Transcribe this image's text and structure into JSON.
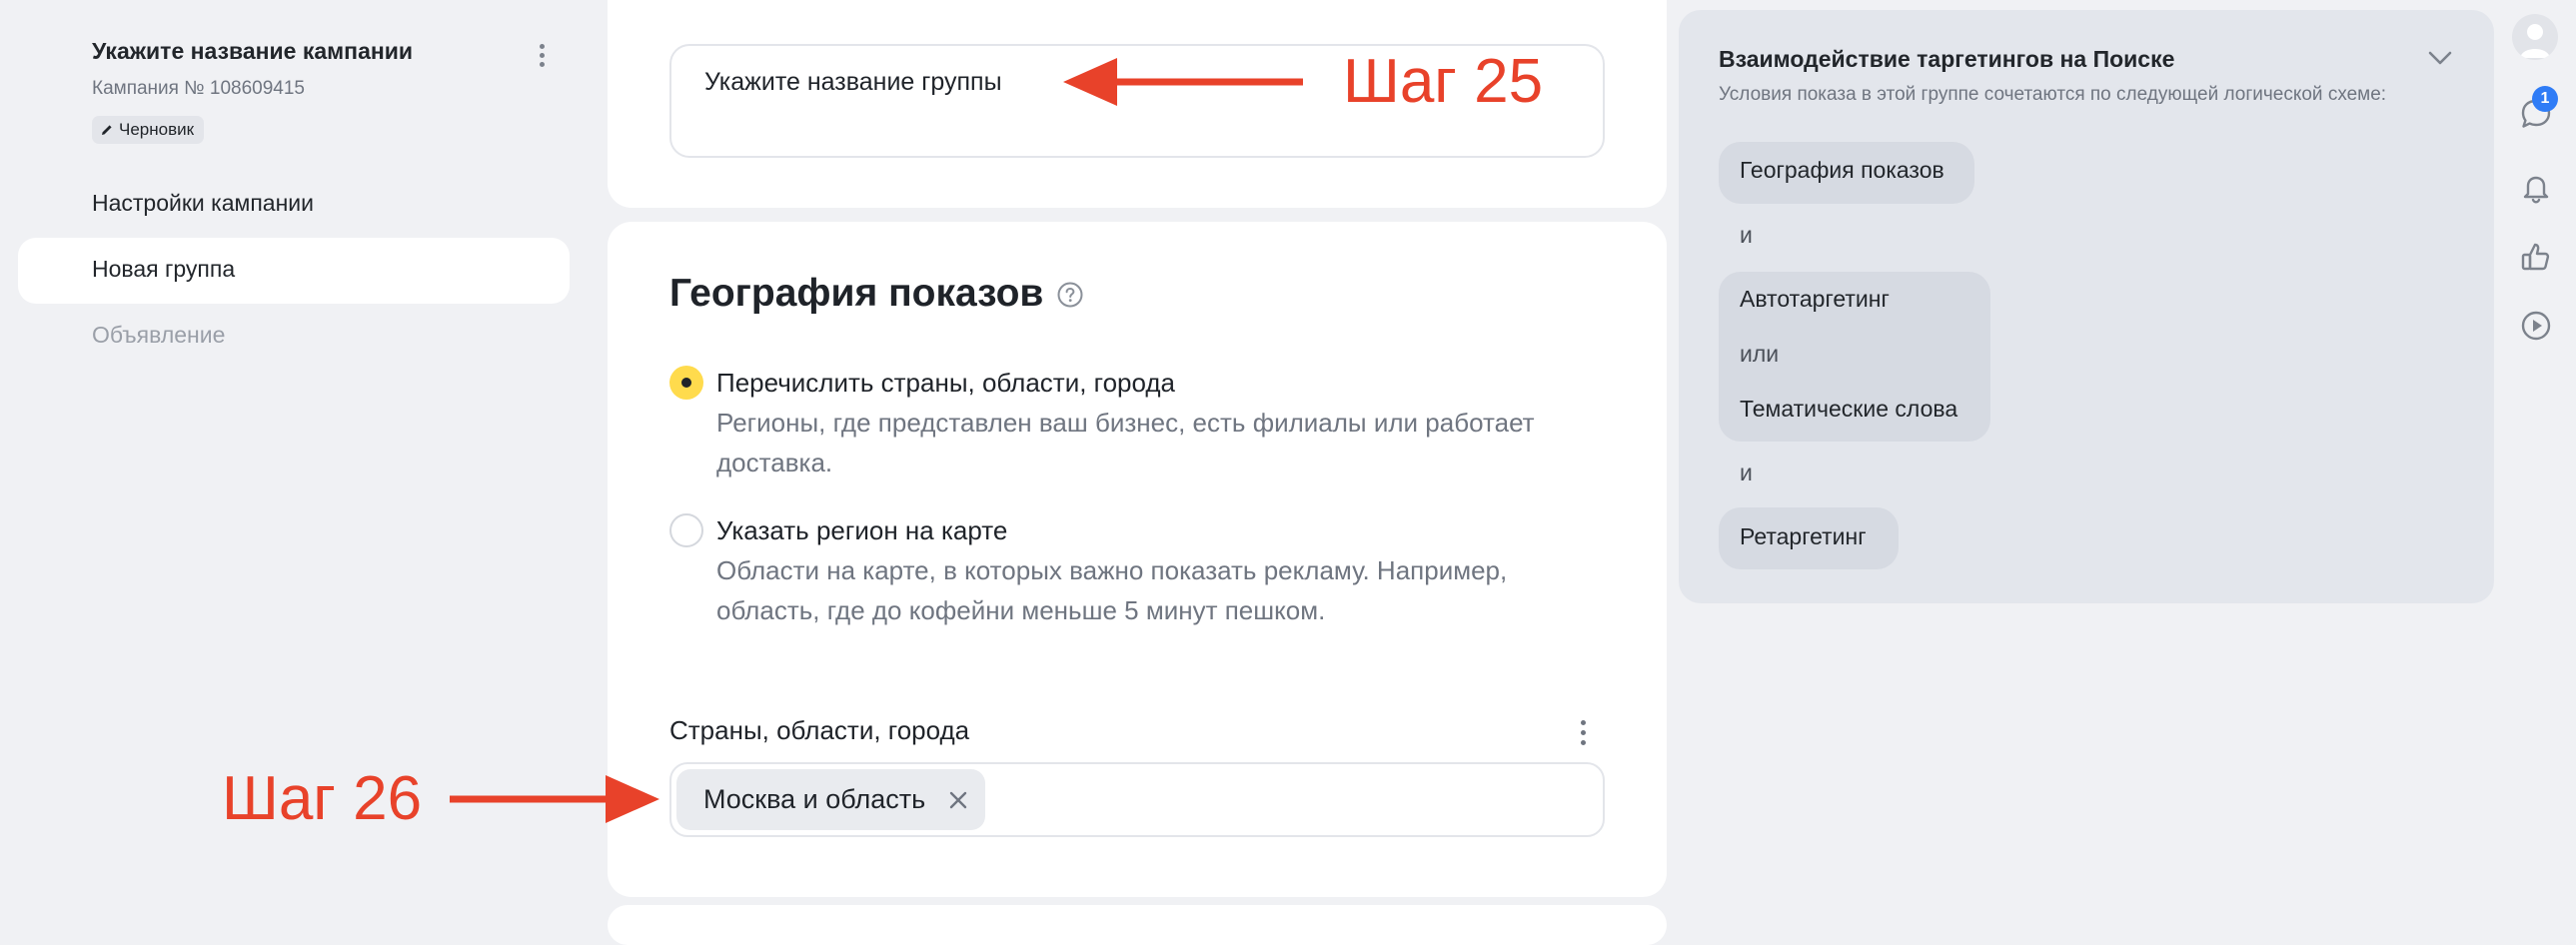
{
  "sidebar": {
    "campaign_title": "Укажите название кампании",
    "campaign_number": "Кампания № 108609415",
    "status_badge": "Черновик",
    "nav": {
      "settings": "Настройки кампании",
      "new_group": "Новая группа",
      "ad": "Объявление"
    }
  },
  "group": {
    "name_placeholder": "Укажите название группы"
  },
  "geo": {
    "title": "География показов",
    "options": [
      {
        "label": "Перечислить страны, области, города",
        "desc": "Регионы, где представлен ваш бизнес, есть филиалы или работает доставка.",
        "selected": true
      },
      {
        "label": "Указать регион на карте",
        "desc": "Области на карте, в которых важно показать рекламу. Например, область, где до кофейни меньше 5 минут пешком.",
        "selected": false
      }
    ],
    "regions_label": "Страны, области, города",
    "selected_region": "Москва и область"
  },
  "annotations": {
    "step25": "Шаг 25",
    "step26": "Шаг 26",
    "color": "#e8422a"
  },
  "panel": {
    "title": "Взаимодействие таргетингов на Поиске",
    "subtitle": "Условия показа в этой группе сочетаются по следующей логической схеме:",
    "item_geo": "География показов",
    "and_1": "и",
    "item_auto": "Автотаргетинг",
    "or": "или",
    "item_thematic": "Тематические слова",
    "and_2": "и",
    "item_retarget": "Ретаргетинг"
  },
  "rail": {
    "messages_count": "1",
    "icons": [
      "avatar-icon",
      "chat-icon",
      "bell-icon",
      "thumbs-up-icon",
      "play-icon"
    ]
  },
  "colors": {
    "background": "#f0f1f4",
    "accent_yellow": "#ffdb4d",
    "badge_blue": "#2f7cf6",
    "panel_bg": "#e3e6ec"
  }
}
